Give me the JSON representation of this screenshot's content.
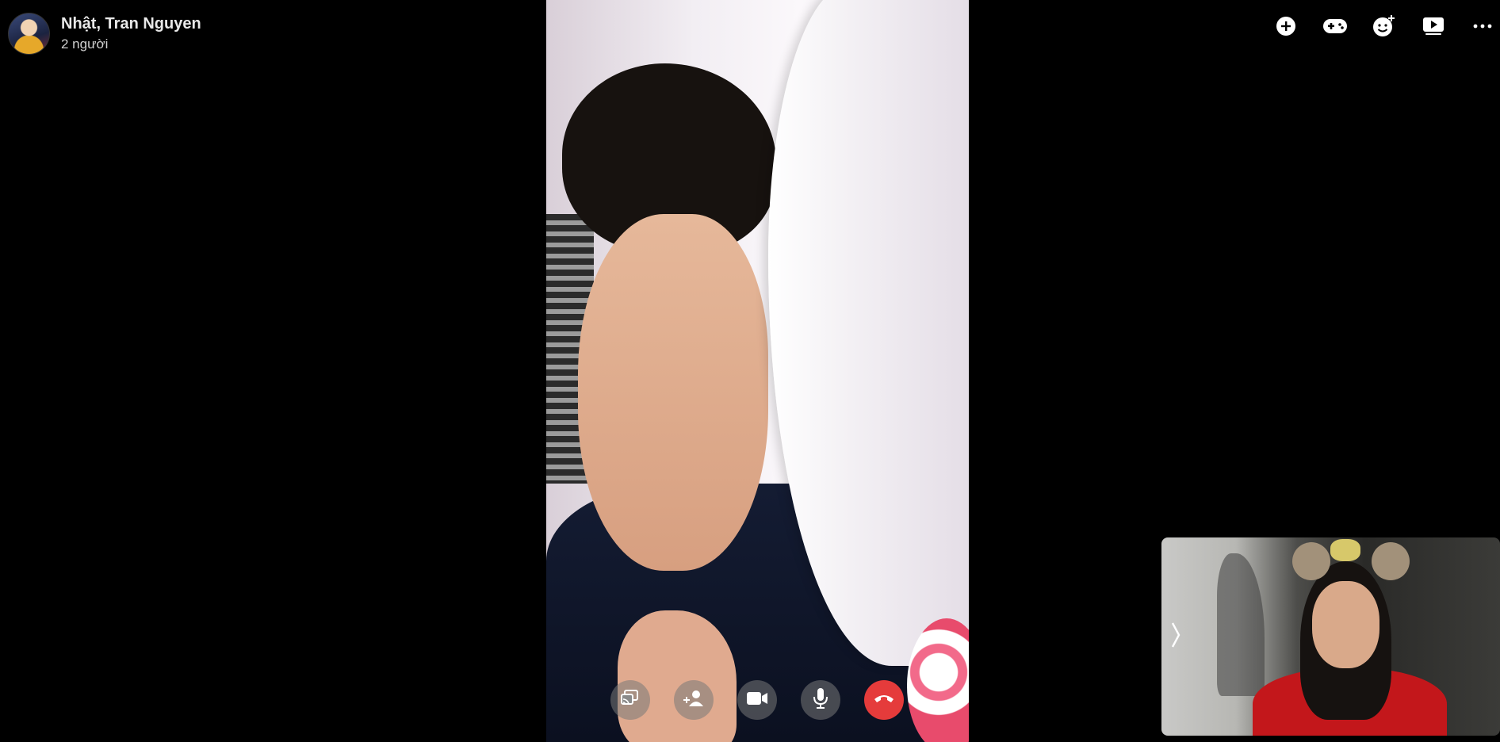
{
  "call": {
    "title": "Nhật, Tran Nguyen",
    "participants": "2 người"
  },
  "top_icons": [
    "add-icon",
    "game-controller-icon",
    "add-emoji-icon",
    "play-video-icon",
    "more-options-icon"
  ],
  "controls": [
    "share-screen-icon",
    "add-person-icon",
    "video-camera-icon",
    "microphone-icon",
    "end-call-icon"
  ],
  "colors": {
    "background": "#000000",
    "end_call": "#e53b3b",
    "control_bg": "#787878"
  }
}
